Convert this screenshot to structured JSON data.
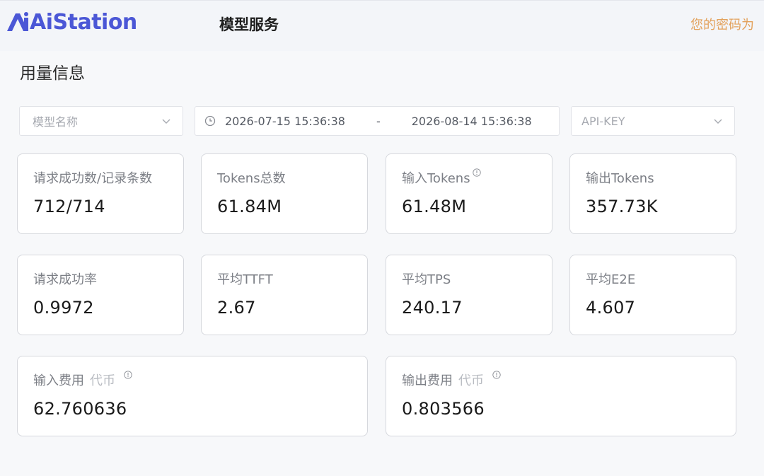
{
  "header": {
    "logo_text": "AiStation",
    "brand_color": "#4b57d6",
    "nav_title": "模型服务",
    "notice": "您的密码为"
  },
  "page": {
    "title": "用量信息"
  },
  "filters": {
    "model_placeholder": "模型名称",
    "date_start": "2026-07-15 15:36:38",
    "date_separator": "-",
    "date_end": "2026-08-14 15:36:38",
    "apikey_placeholder": "API-KEY"
  },
  "stats": [
    {
      "label": "请求成功数/记录条数",
      "value": "712/714"
    },
    {
      "label": "Tokens总数",
      "value": "61.84M"
    },
    {
      "label": "输入Tokens",
      "value": "61.48M",
      "has_info": true
    },
    {
      "label": "输出Tokens",
      "value": "357.73K"
    },
    {
      "label": "请求成功率",
      "value": "0.9972"
    },
    {
      "label": "平均TTFT",
      "value": "2.67"
    },
    {
      "label": "平均TPS",
      "value": "240.17"
    },
    {
      "label": "平均E2E",
      "value": "4.607"
    }
  ],
  "costs": [
    {
      "label": "输入费用",
      "unit": "代币",
      "value": "62.760636",
      "has_info": true
    },
    {
      "label": "输出费用",
      "unit": "代币",
      "value": "0.803566",
      "has_info": true
    }
  ]
}
